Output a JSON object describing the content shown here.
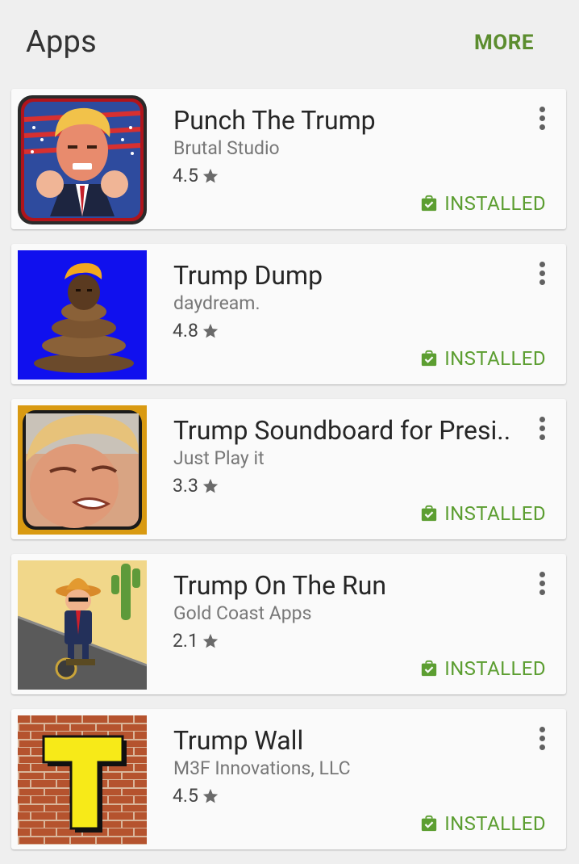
{
  "header": {
    "title": "Apps",
    "more_label": "MORE"
  },
  "colors": {
    "accent_green": "#5c9e31",
    "background": "#efefef",
    "card": "#fafafa"
  },
  "apps": [
    {
      "title": "Punch The Trump",
      "developer": "Brutal Studio",
      "rating": "4.5",
      "status": "INSTALLED",
      "icon": "punch-the-trump-app-icon"
    },
    {
      "title": "Trump Dump",
      "developer": "daydream.",
      "rating": "4.8",
      "status": "INSTALLED",
      "icon": "trump-dump-app-icon"
    },
    {
      "title": "Trump Soundboard for Presi..",
      "developer": "Just Play it",
      "rating": "3.3",
      "status": "INSTALLED",
      "icon": "trump-soundboard-app-icon"
    },
    {
      "title": "Trump On The Run",
      "developer": "Gold Coast Apps",
      "rating": "2.1",
      "status": "INSTALLED",
      "icon": "trump-on-the-run-app-icon"
    },
    {
      "title": "Trump Wall",
      "developer": "M3F Innovations, LLC",
      "rating": "4.5",
      "status": "INSTALLED",
      "icon": "trump-wall-app-icon"
    }
  ]
}
